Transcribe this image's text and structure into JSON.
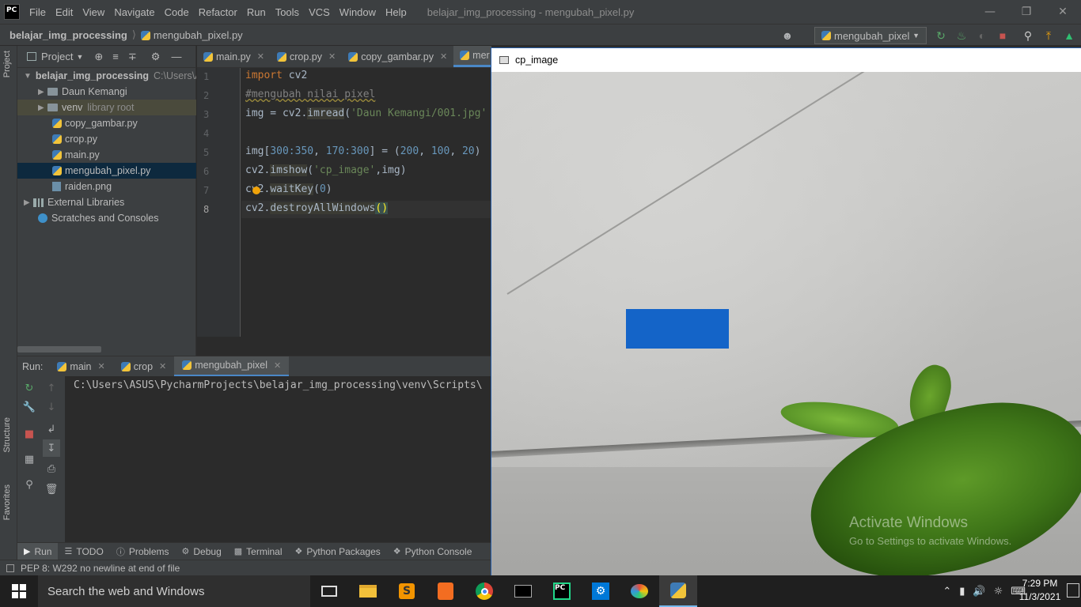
{
  "app": {
    "logo_text": "PC",
    "menu": [
      "File",
      "Edit",
      "View",
      "Navigate",
      "Code",
      "Refactor",
      "Run",
      "Tools",
      "VCS",
      "Window",
      "Help"
    ],
    "window_title": "belajar_img_processing - mengubah_pixel.py"
  },
  "navbar": {
    "project": "belajar_img_processing",
    "file": "mengubah_pixel.py",
    "run_config": "mengubah_pixel"
  },
  "left_strip": {
    "project_tab": "Project",
    "structure_tab": "Structure",
    "favorites_tab": "Favorites"
  },
  "project_panel": {
    "title": "Project",
    "tree": [
      {
        "label": "belajar_img_processing",
        "extra": "C:\\Users\\A"
      },
      {
        "label": "Daun Kemangi"
      },
      {
        "label": "venv",
        "extra": "library root"
      },
      {
        "label": "copy_gambar.py"
      },
      {
        "label": "crop.py"
      },
      {
        "label": "main.py"
      },
      {
        "label": "mengubah_pixel.py"
      },
      {
        "label": "raiden.png"
      },
      {
        "label": "External Libraries"
      },
      {
        "label": "Scratches and Consoles"
      }
    ]
  },
  "editor": {
    "tabs": [
      "main.py",
      "crop.py",
      "copy_gambar.py",
      "mer"
    ],
    "line_numbers": [
      "1",
      "2",
      "3",
      "4",
      "5",
      "6",
      "7",
      "8"
    ],
    "code": {
      "l1_kw": "import",
      "l1_rest": " cv2",
      "l2": "#mengubah nilai pixel",
      "l3_a": "img = cv2.",
      "l3_fn": "imread",
      "l3_b": "(",
      "l3_str": "'Daun Kemangi/001.jpg'",
      "l5_a": "img[",
      "l5_n1": "300",
      "l5_c": ":",
      "l5_n2": "350",
      "l5_d": ", ",
      "l5_n3": "170",
      "l5_e": ":",
      "l5_n4": "300",
      "l5_f": "] = (",
      "l5_n5": "200",
      "l5_g": ", ",
      "l5_n6": "100",
      "l5_h": ", ",
      "l5_n7": "20",
      "l5_i": ")",
      "l6_a": "cv2.",
      "l6_fn": "imshow",
      "l6_b": "(",
      "l6_str": "'cp_image'",
      "l6_c": ",img)",
      "l7_a": "cv2.",
      "l7_fn": "waitKey",
      "l7_b": "(",
      "l7_n": "0",
      "l7_c": ")",
      "l8_a": "cv2.",
      "l8_fn": "destroyAllWindows",
      "l8_b": "()"
    }
  },
  "run_panel": {
    "label": "Run:",
    "tabs": [
      "main",
      "crop",
      "mengubah_pixel"
    ],
    "console": "C:\\Users\\ASUS\\PycharmProjects\\belajar_img_processing\\venv\\Scripts\\"
  },
  "bottom_tabs": [
    "Run",
    "TODO",
    "Problems",
    "Debug",
    "Terminal",
    "Python Packages",
    "Python Console"
  ],
  "status": "PEP 8: W292 no newline at end of file",
  "cv_window": {
    "title": "cp_image",
    "watermark_title": "Activate Windows",
    "watermark_sub": "Go to Settings to activate Windows."
  },
  "taskbar": {
    "search_placeholder": "Search the web and Windows",
    "time": "7:29 PM",
    "date": "11/3/2021"
  },
  "colors": {
    "accent": "#4a88c7",
    "drawn_rect": "#1464c8"
  }
}
